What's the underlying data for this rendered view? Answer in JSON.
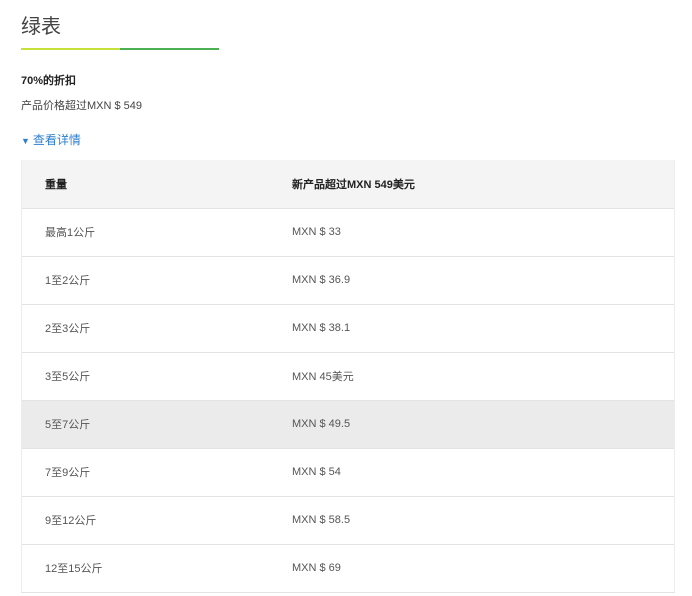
{
  "title": "绿表",
  "progress": {
    "fill_fraction": 0.5,
    "fill_color": "#c6e03a",
    "track_color": "#4caf50"
  },
  "discount": {
    "title": "70%的折扣",
    "description": "产品价格超过MXN $ 549"
  },
  "details_toggle": {
    "icon": "caret-down-icon",
    "label": "查看详情",
    "color": "#2c7fd0"
  },
  "table": {
    "headers": [
      "重量",
      "新产品超过MXN 549美元"
    ],
    "rows": [
      [
        "最高1公斤",
        "MXN $ 33"
      ],
      [
        "1至2公斤",
        "MXN $ 36.9"
      ],
      [
        "2至3公斤",
        "MXN $ 38.1"
      ],
      [
        "3至5公斤",
        "MXN 45美元"
      ],
      [
        "5至7公斤",
        "MXN $ 49.5"
      ],
      [
        "7至9公斤",
        "MXN $ 54"
      ],
      [
        "9至12公斤",
        "MXN $ 58.5"
      ],
      [
        "12至15公斤",
        "MXN $ 69"
      ]
    ],
    "highlighted_row": 4
  }
}
